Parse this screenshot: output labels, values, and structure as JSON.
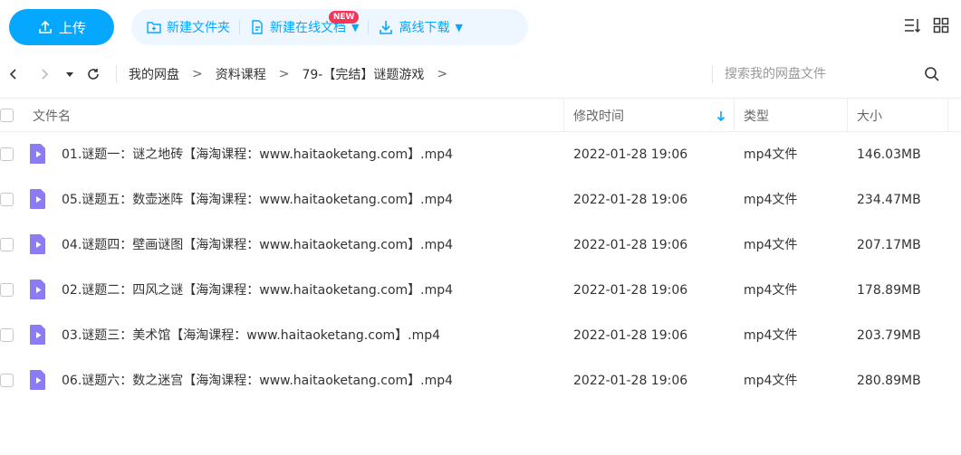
{
  "toolbar": {
    "upload_label": "上传",
    "new_folder_label": "新建文件夹",
    "new_online_doc_label": "新建在线文档",
    "new_badge": "NEW",
    "offline_download_label": "离线下载"
  },
  "nav": {
    "breadcrumb": [
      "我的网盘",
      "资料课程",
      "79-【完结】谜题游戏"
    ],
    "breadcrumb_sep": ">",
    "search_placeholder": "搜索我的网盘文件"
  },
  "table": {
    "columns": {
      "name": "文件名",
      "modified": "修改时间",
      "type": "类型",
      "size": "大小"
    },
    "rows": [
      {
        "name": "01.谜题一：谜之地砖【海淘课程：www.haitaoketang.com】.mp4",
        "modified": "2022-01-28 19:06",
        "type": "mp4文件",
        "size": "146.03MB"
      },
      {
        "name": "05.谜题五：数壶迷阵【海淘课程：www.haitaoketang.com】.mp4",
        "modified": "2022-01-28 19:06",
        "type": "mp4文件",
        "size": "234.47MB"
      },
      {
        "name": "04.谜题四：壁画谜图【海淘课程：www.haitaoketang.com】.mp4",
        "modified": "2022-01-28 19:06",
        "type": "mp4文件",
        "size": "207.17MB"
      },
      {
        "name": "02.谜题二：四风之谜【海淘课程：www.haitaoketang.com】.mp4",
        "modified": "2022-01-28 19:06",
        "type": "mp4文件",
        "size": "178.89MB"
      },
      {
        "name": "03.谜题三：美术馆【海淘课程：www.haitaoketang.com】.mp4",
        "modified": "2022-01-28 19:06",
        "type": "mp4文件",
        "size": "203.79MB"
      },
      {
        "name": "06.谜题六：数之迷宫【海淘课程：www.haitaoketang.com】.mp4",
        "modified": "2022-01-28 19:06",
        "type": "mp4文件",
        "size": "280.89MB"
      }
    ]
  },
  "colors": {
    "accent": "#06a7ff",
    "toolbar_bg": "#eef7ff",
    "badge": "#f7355b",
    "video_icon": "#8b7cf6"
  },
  "icons": {
    "upload": "upload-arrow-icon",
    "new_folder": "folder-plus-icon",
    "online_doc": "doc-edit-icon",
    "download": "download-icon",
    "sort": "sort-list-icon",
    "grid": "grid-view-icon",
    "video": "video-file-icon"
  }
}
